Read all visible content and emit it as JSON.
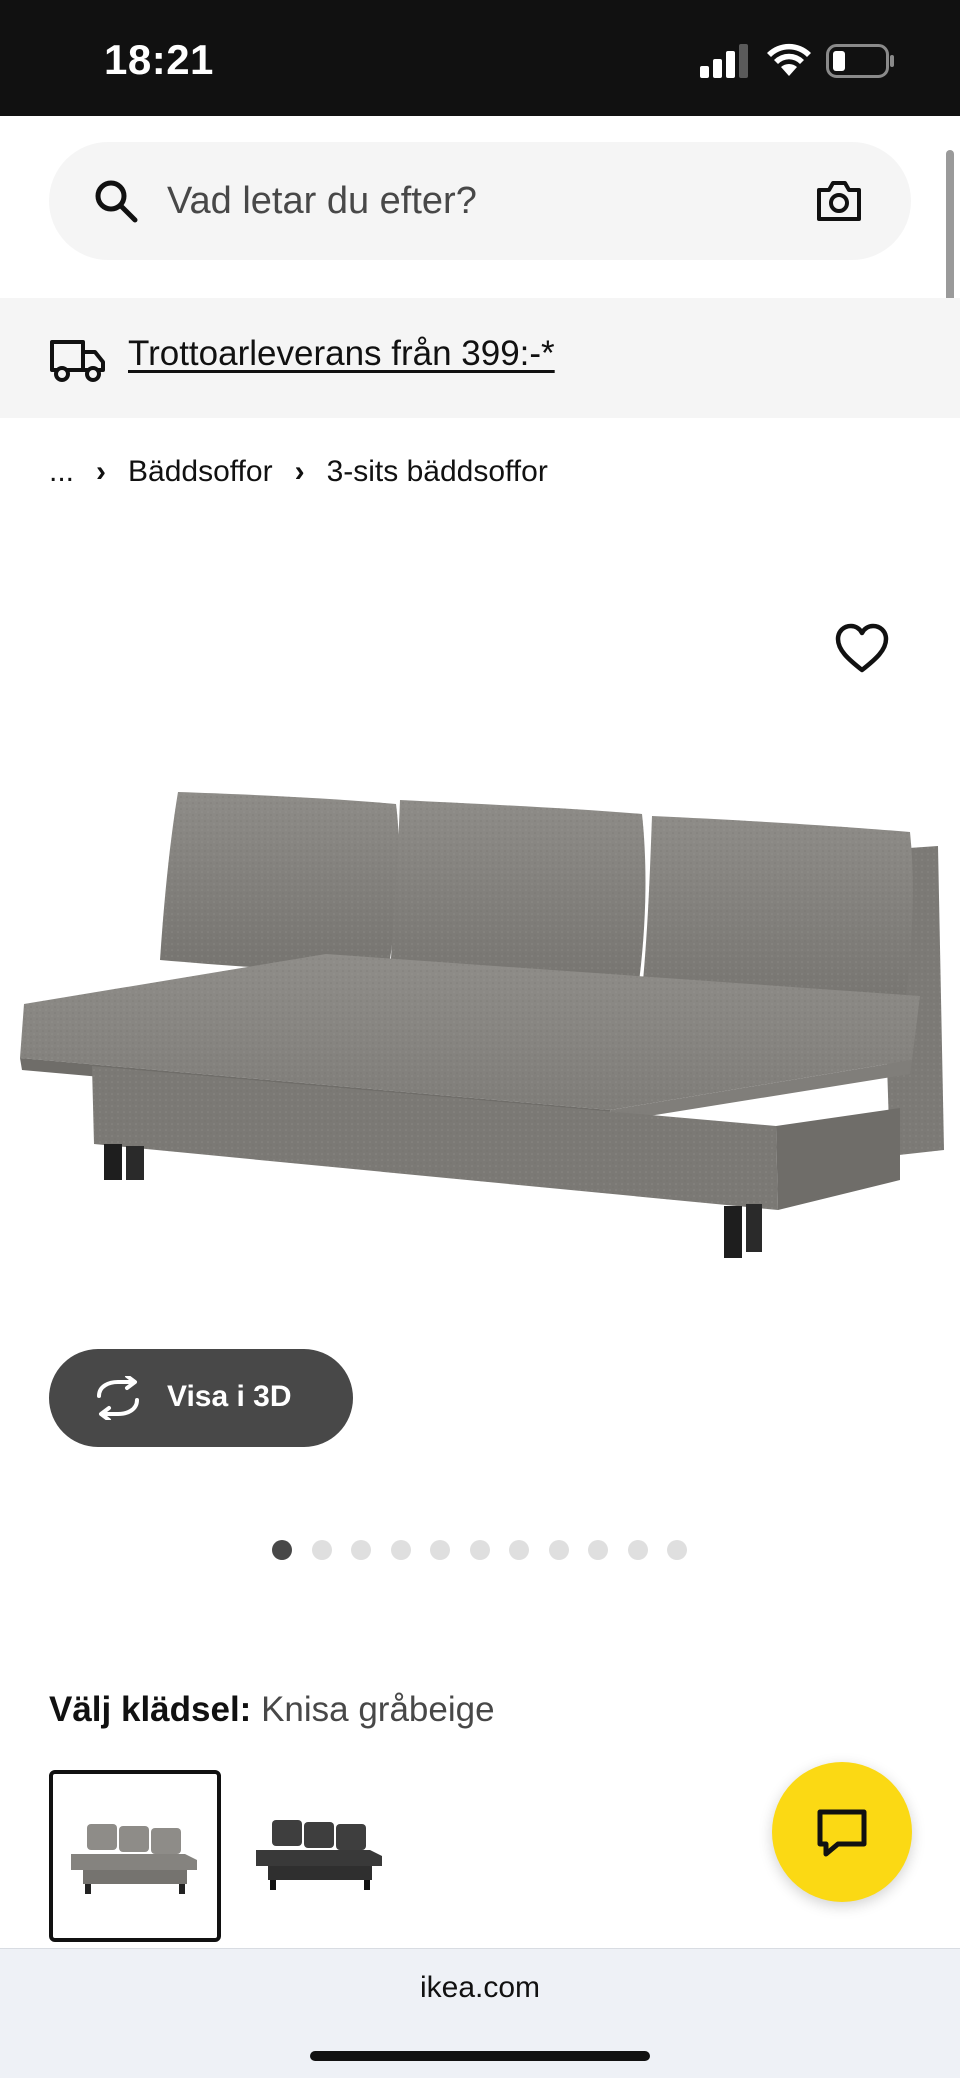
{
  "status_bar": {
    "time": "18:21"
  },
  "search": {
    "placeholder": "Vad letar du efter?"
  },
  "delivery_banner": {
    "text": "Trottoarleverans från 399:-*"
  },
  "breadcrumb": {
    "ellipsis": "...",
    "separator": "›",
    "items": [
      "Bäddsoffor",
      "3-sits bäddsoffor"
    ]
  },
  "product": {
    "view_3d_label": "Visa i 3D",
    "image_count": 11,
    "active_image_index": 0
  },
  "variant": {
    "label": "Välj klädsel:",
    "selected": "Knisa gråbeige",
    "options": [
      "Knisa gråbeige",
      "dark grey"
    ]
  },
  "browser": {
    "url": "ikea.com"
  },
  "colors": {
    "status_bar_bg": "#111111",
    "surface": "#f5f5f5",
    "button_dark": "#484848",
    "chat_yellow": "#fbd914",
    "fabric_grey": "#8a8884",
    "fabric_dark": "#3c3c3c"
  },
  "icons": {
    "search": "search-icon",
    "camera": "camera-icon",
    "truck": "truck-icon",
    "favorite": "heart-icon",
    "rotate": "rotate-3d-icon",
    "chat": "chat-bubble-icon"
  }
}
